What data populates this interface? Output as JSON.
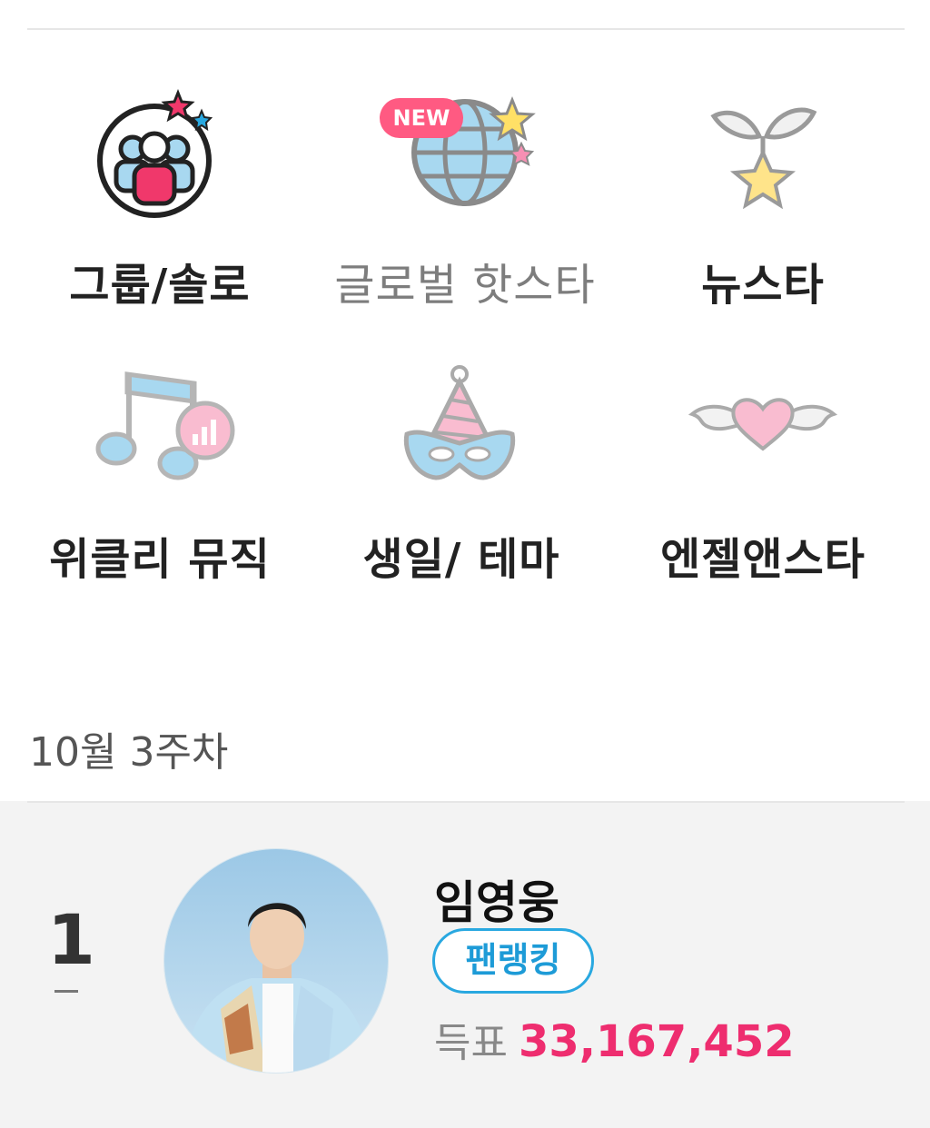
{
  "menu": {
    "items": [
      {
        "label": "그룹/솔로",
        "icon": "group-solo-icon"
      },
      {
        "label": "글로벌 핫스타",
        "icon": "globe-icon",
        "badge": "NEW"
      },
      {
        "label": "뉴스타",
        "icon": "sprout-star-icon"
      },
      {
        "label": "위클리 뮤직",
        "icon": "music-note-icon"
      },
      {
        "label": "생일/ 테마",
        "icon": "party-hat-mask-icon"
      },
      {
        "label": "엔젤앤스타",
        "icon": "winged-heart-icon"
      }
    ]
  },
  "ranking": {
    "week_label": "10월 3주차",
    "entries": [
      {
        "rank": "1",
        "change": "–",
        "name": "임영웅",
        "badge": "팬랭킹",
        "votes_label": "득표",
        "votes": "33,167,452"
      }
    ]
  },
  "colors": {
    "accent_pink": "#ee2d6f",
    "accent_blue": "#29a8e0"
  }
}
